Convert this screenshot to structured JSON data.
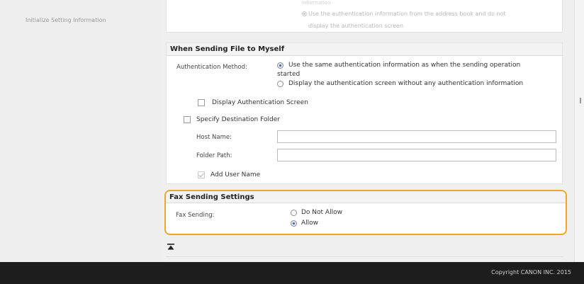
{
  "sidebar": {
    "items": [
      {
        "label": "Initialize Setting Information"
      }
    ]
  },
  "top_partial": {
    "faint_line": "information",
    "option_line1": "Use the authentication information from the address book and do not",
    "option_line2": "display the authentication screen"
  },
  "send_to_myself": {
    "title": "When Sending File to Myself",
    "auth_method_label": "Authentication Method:",
    "auth_option_same_line1": "Use the same authentication information as when the sending operation",
    "auth_option_same_line2": "started",
    "auth_option_display": "Display the authentication screen without any authentication information",
    "auth_selected": "same",
    "display_auth_screen_label": "Display Authentication Screen",
    "display_auth_screen_checked": false,
    "specify_dest_label": "Specify Destination Folder",
    "specify_dest_checked": false,
    "host_name_label": "Host Name:",
    "host_name_value": "",
    "folder_path_label": "Folder Path:",
    "folder_path_value": "",
    "add_user_name_label": "Add User Name",
    "add_user_name_checked": true
  },
  "fax_settings": {
    "title": "Fax Sending Settings",
    "fax_sending_label": "Fax Sending:",
    "option_not_allow": "Do Not Allow",
    "option_allow": "Allow",
    "selected": "allow"
  },
  "footer": {
    "copyright": "Copyright CANON INC. 2015"
  },
  "colors": {
    "highlight_border": "#f0a42a",
    "footer_bg": "#1d1d1d",
    "sidebar_bg": "#eeeeee"
  },
  "icons": {
    "back_to_top": "back-to-top-icon"
  }
}
